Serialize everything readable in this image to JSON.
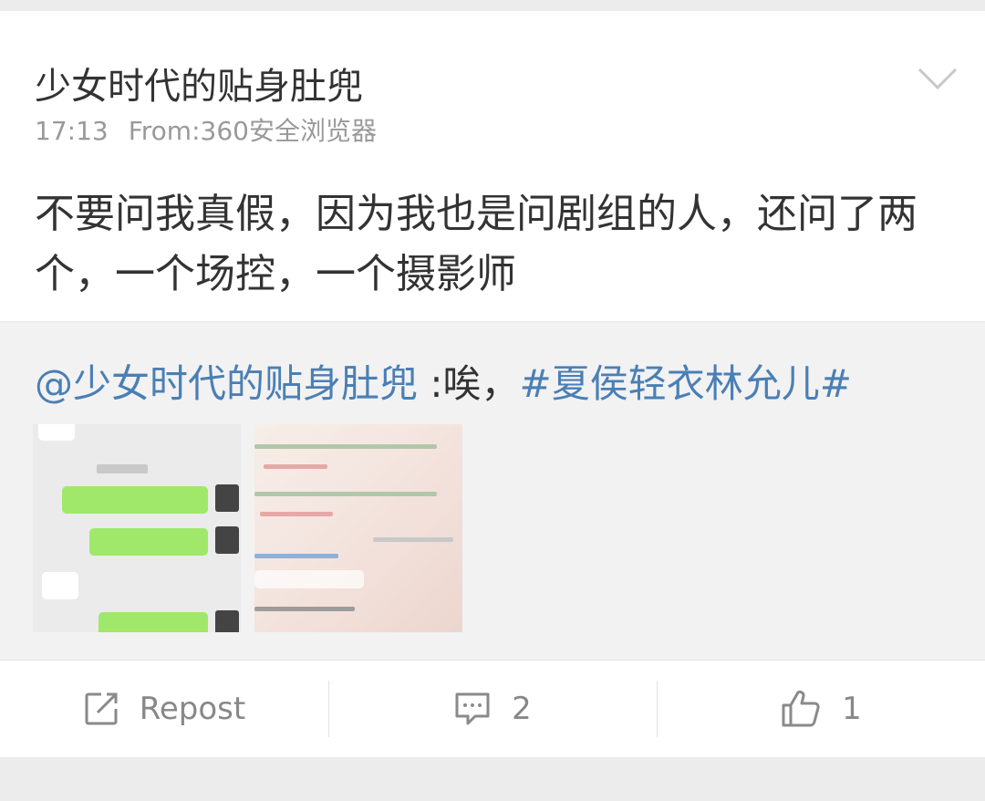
{
  "post": {
    "author": "少女时代的贴身肚兜",
    "time": "17:13",
    "source": "From:360安全浏览器",
    "text": "不要问我真假，因为我也是问剧组的人，还问了两个，一个场控，一个摄影师"
  },
  "repost": {
    "mention": "@少女时代的贴身肚兜",
    "separator": " :唉，",
    "topic": "#夏侯轻衣林允儿#",
    "images": [
      "chat-screenshot-1",
      "chat-screenshot-2"
    ]
  },
  "actions": {
    "repost_label": "Repost",
    "comment_count": "2",
    "like_count": "1"
  },
  "colors": {
    "link": "#4a7fb5",
    "text": "#333333",
    "meta": "#999999",
    "icon": "#8a8a8a"
  },
  "icons": [
    "chevron-down-icon",
    "repost-icon",
    "comment-icon",
    "like-icon"
  ]
}
